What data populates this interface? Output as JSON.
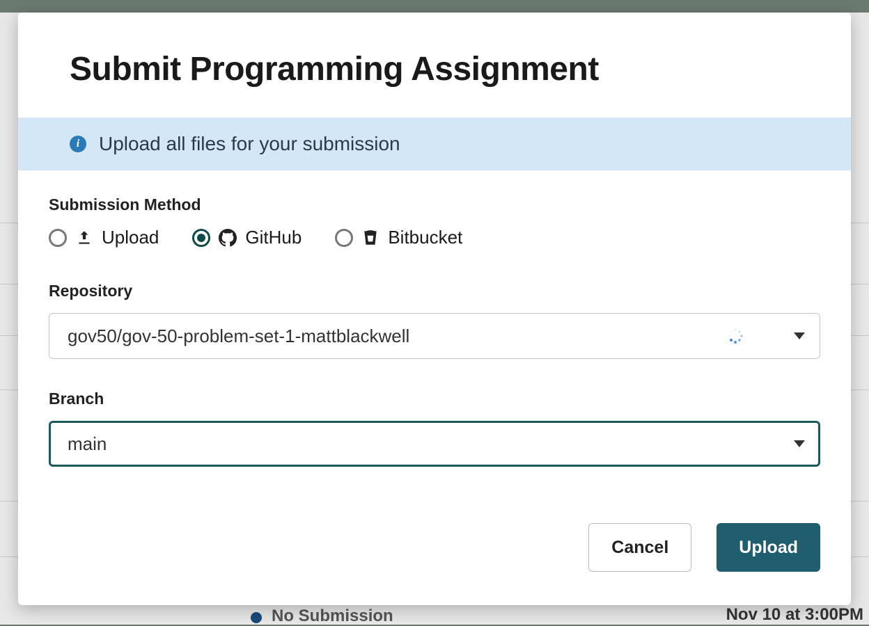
{
  "modal": {
    "title": "Submit Programming Assignment",
    "info_message": "Upload all files for your submission"
  },
  "submission_method": {
    "label": "Submission Method",
    "options": [
      {
        "id": "upload",
        "label": "Upload",
        "selected": false
      },
      {
        "id": "github",
        "label": "GitHub",
        "selected": true
      },
      {
        "id": "bitbucket",
        "label": "Bitbucket",
        "selected": false
      }
    ]
  },
  "repository": {
    "label": "Repository",
    "value": "gov50/gov-50-problem-set-1-mattblackwell",
    "loading": true
  },
  "branch": {
    "label": "Branch",
    "value": "main"
  },
  "actions": {
    "cancel_label": "Cancel",
    "upload_label": "Upload"
  },
  "background": {
    "no_submission_text": "No Submission",
    "due_text": "Nov 10 at 3:00PM"
  }
}
